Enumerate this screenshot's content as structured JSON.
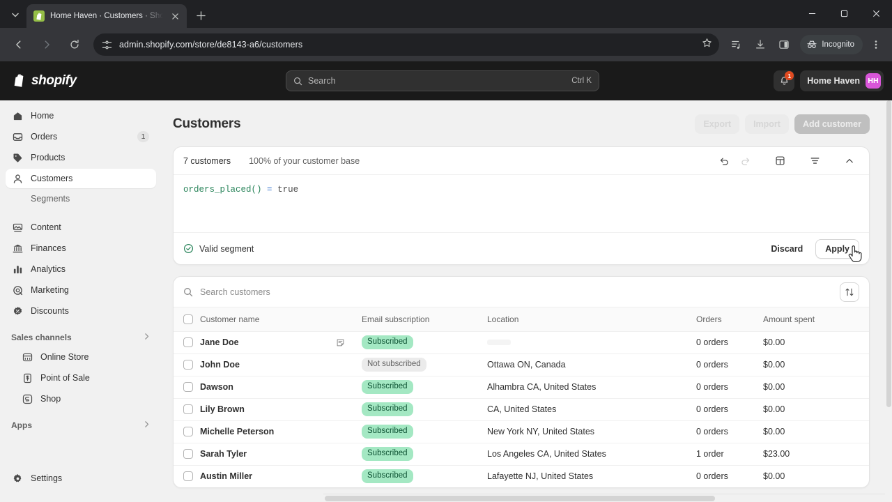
{
  "browser": {
    "tab": {
      "title": "Home Haven · Customers · Sho",
      "favicon": "shopify-bag-icon"
    },
    "new_tab_label": "+",
    "url": "admin.shopify.com/store/de8143-a6/customers",
    "profile_label": "Incognito",
    "icons": {
      "back": "back-arrow-icon",
      "forward": "forward-arrow-icon",
      "reload": "reload-icon",
      "site_info": "site-settings-icon",
      "bookmark": "star-icon",
      "reading_list": "reading-list-icon",
      "downloads": "download-icon",
      "side_panel": "side-panel-icon",
      "menu": "kebab-menu-icon"
    },
    "window": {
      "minimize": "minimize-icon",
      "maximize": "maximize-icon",
      "close": "close-icon"
    }
  },
  "topbar": {
    "brand": "shopify",
    "search_placeholder": "Search",
    "search_shortcut": "Ctrl K",
    "notification_count": "1",
    "store_name": "Home Haven",
    "avatar_initials": "HH"
  },
  "sidebar": {
    "items": [
      {
        "label": "Home",
        "icon": "home-icon",
        "badge": "",
        "active": false
      },
      {
        "label": "Orders",
        "icon": "orders-icon",
        "badge": "1",
        "active": false
      },
      {
        "label": "Products",
        "icon": "products-tag-icon",
        "badge": "",
        "active": false
      },
      {
        "label": "Customers",
        "icon": "customers-person-icon",
        "badge": "",
        "active": true
      },
      {
        "label": "Content",
        "icon": "content-icon",
        "badge": "",
        "active": false
      },
      {
        "label": "Finances",
        "icon": "finances-bank-icon",
        "badge": "",
        "active": false
      },
      {
        "label": "Analytics",
        "icon": "analytics-bars-icon",
        "badge": "",
        "active": false
      },
      {
        "label": "Marketing",
        "icon": "marketing-target-icon",
        "badge": "",
        "active": false
      },
      {
        "label": "Discounts",
        "icon": "discounts-badge-icon",
        "badge": "",
        "active": false
      }
    ],
    "sub_item": "Segments",
    "groups": [
      {
        "label": "Sales channels",
        "items": [
          {
            "label": "Online Store",
            "icon": "online-store-icon"
          },
          {
            "label": "Point of Sale",
            "icon": "point-of-sale-icon"
          },
          {
            "label": "Shop",
            "icon": "shop-icon"
          }
        ]
      },
      {
        "label": "Apps",
        "items": []
      }
    ],
    "settings": {
      "label": "Settings",
      "icon": "gear-icon"
    }
  },
  "page": {
    "title": "Customers",
    "actions": [
      {
        "label": "Export",
        "style": "ghost-loading"
      },
      {
        "label": "Import",
        "style": "ghost-loading"
      },
      {
        "label": "Add customer",
        "style": "primary-loading"
      }
    ]
  },
  "segment": {
    "count": "7 customers",
    "percent": "100% of your customer base",
    "tools": [
      {
        "name": "undo-icon",
        "disabled": false
      },
      {
        "name": "redo-icon",
        "disabled": true
      },
      {
        "name": "template-icon",
        "disabled": false
      },
      {
        "name": "filter-icon",
        "disabled": false
      },
      {
        "name": "chevron-up-icon",
        "disabled": false
      }
    ],
    "query": {
      "function": "orders_placed()",
      "operator": "=",
      "value": "true"
    },
    "validity": "Valid segment",
    "discard_label": "Discard",
    "apply_label": "Apply"
  },
  "table": {
    "search_placeholder": "Search customers",
    "sort_icon": "sort-arrows-icon",
    "columns": [
      "Customer name",
      "Email subscription",
      "Location",
      "Orders",
      "Amount spent"
    ],
    "rows": [
      {
        "name": "Jane Doe",
        "note": true,
        "email": "Subscribed",
        "subscribed": true,
        "location": "",
        "location_loading": true,
        "orders": "0 orders",
        "amount": "$0.00"
      },
      {
        "name": "John Doe",
        "note": false,
        "email": "Not subscribed",
        "subscribed": false,
        "location": "Ottawa ON, Canada",
        "location_loading": false,
        "orders": "0 orders",
        "amount": "$0.00"
      },
      {
        "name": "Dawson",
        "note": false,
        "email": "Subscribed",
        "subscribed": true,
        "location": "Alhambra CA, United States",
        "location_loading": false,
        "orders": "0 orders",
        "amount": "$0.00"
      },
      {
        "name": "Lily Brown",
        "note": false,
        "email": "Subscribed",
        "subscribed": true,
        "location": "CA, United States",
        "location_loading": false,
        "orders": "0 orders",
        "amount": "$0.00"
      },
      {
        "name": "Michelle Peterson",
        "note": false,
        "email": "Subscribed",
        "subscribed": true,
        "location": "New York NY, United States",
        "location_loading": false,
        "orders": "0 orders",
        "amount": "$0.00"
      },
      {
        "name": "Sarah Tyler",
        "note": false,
        "email": "Subscribed",
        "subscribed": true,
        "location": "Los Angeles CA, United States",
        "location_loading": false,
        "orders": "1 order",
        "amount": "$23.00"
      },
      {
        "name": "Austin Miller",
        "note": false,
        "email": "Subscribed",
        "subscribed": true,
        "location": "Lafayette NJ, United States",
        "location_loading": false,
        "orders": "0 orders",
        "amount": "$0.00"
      }
    ]
  },
  "colors": {
    "chrome_tabstrip": "#202124",
    "chrome_toolbar": "#35363a",
    "shopify_topbar": "#1a1a1a",
    "page_bg": "#f1f1f1",
    "badge_subscribed_bg": "#a4e8c3",
    "badge_subscribed_text": "#0c5132",
    "avatar_bg": "#d956d9",
    "notification_badge": "#e04a20",
    "code_function": "#29845a",
    "code_operator": "#2c6ecb"
  }
}
